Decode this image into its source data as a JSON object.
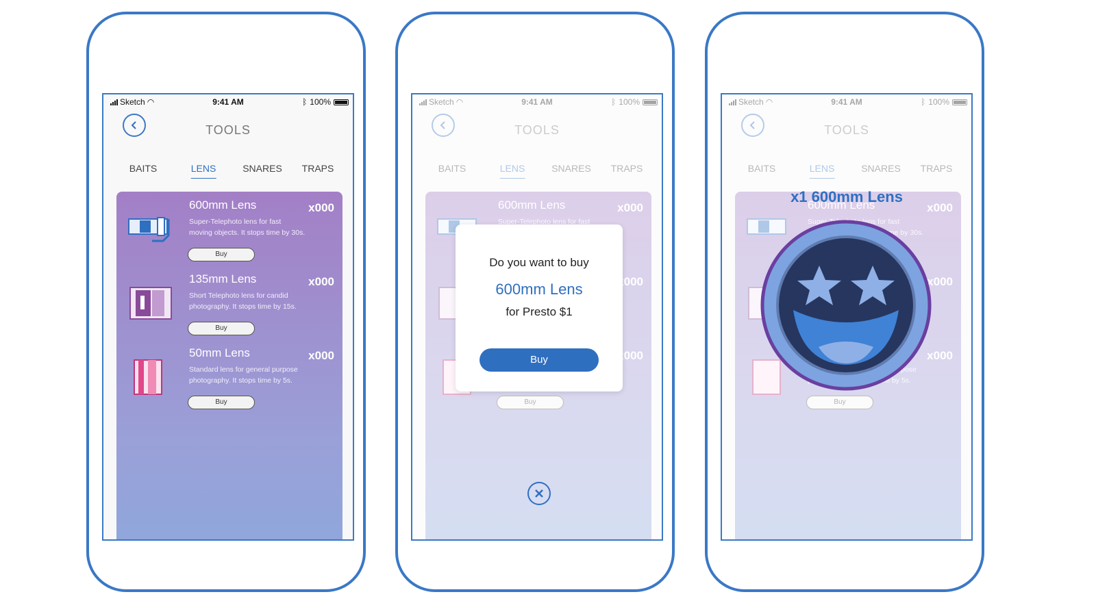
{
  "screens": [
    {
      "status": {
        "carrier": "Sketch",
        "time": "9:41 AM",
        "battery": "100%"
      },
      "title": "TOOLS",
      "tabs": [
        "BAITS",
        "LENS",
        "SNARES",
        "TRAPS"
      ],
      "active_tab": "LENS",
      "items": [
        {
          "name": "600mm Lens",
          "description": "Super-Telephoto lens for fast moving objects. It stops time by 30s.",
          "qty": "x000",
          "buy": "Buy",
          "icon": "telephoto-lens-icon"
        },
        {
          "name": "135mm Lens",
          "description": "Short Telephoto lens for candid photography. It stops time by 15s.",
          "qty": "x000",
          "buy": "Buy",
          "icon": "short-lens-icon"
        },
        {
          "name": "50mm Lens",
          "description": "Standard lens for general purpose photography. It stops time by 5s.",
          "qty": "x000",
          "buy": "Buy",
          "icon": "standard-lens-icon"
        }
      ]
    },
    {
      "modal": {
        "question": "Do you want to buy",
        "item": "600mm Lens",
        "price": "for Presto $1",
        "buy": "Buy"
      }
    },
    {
      "reward": {
        "title": "x1 600mm Lens",
        "icon": "star-eyes-smiley-icon"
      }
    }
  ],
  "colors": {
    "accent": "#2f6fc0",
    "frame": "#3a78c6",
    "card_top": "#a37fc6",
    "card_bottom": "#8fa7dc",
    "badge_ring": "#6a3fa0"
  }
}
